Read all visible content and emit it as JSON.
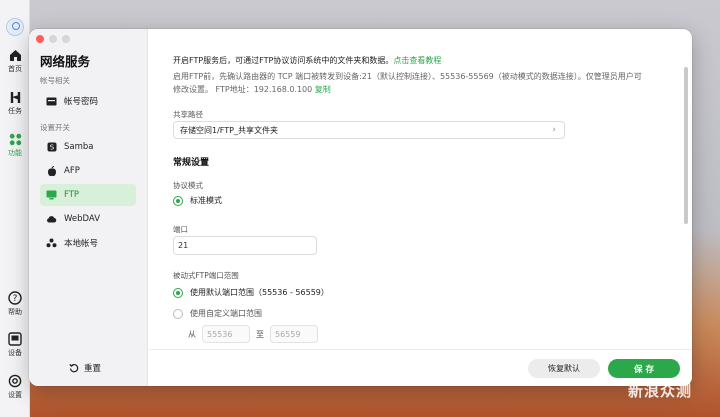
{
  "rail": {
    "items": [
      {
        "label": "首页",
        "icon": "home-icon"
      },
      {
        "label": "任务",
        "icon": "tasks-icon"
      },
      {
        "label": "功能",
        "icon": "apps-icon",
        "active": true
      },
      {
        "label": "帮助",
        "icon": "help-icon"
      },
      {
        "label": "设备",
        "icon": "device-icon"
      },
      {
        "label": "设置",
        "icon": "settings-icon"
      }
    ]
  },
  "sidebar": {
    "title": "网络服务",
    "group_account": "帐号相关",
    "group_settings": "设置开关",
    "items": [
      {
        "label": "帐号密码",
        "icon": "card-icon"
      },
      {
        "label": "Samba",
        "icon": "samba-icon"
      },
      {
        "label": "AFP",
        "icon": "apple-icon"
      },
      {
        "label": "FTP",
        "icon": "ftp-icon",
        "active": true
      },
      {
        "label": "WebDAV",
        "icon": "cloud-icon"
      },
      {
        "label": "本地帐号",
        "icon": "users-icon"
      }
    ],
    "reset_label": "重置"
  },
  "main": {
    "intro_line1": "开启FTP服务后，可通过FTP协议访问系统中的文件夹和数据。",
    "intro_link": "点击查看教程",
    "intro_line2": "启用FTP前，先确认路由器的 TCP 端口被转发到设备:21（默认控制连接）、55536-55569（被动模式的数据连接）。仅管理员用户可修改设置。 FTP地址：192.168.0.100",
    "copy_link": "复制",
    "share_path_label": "共享路径",
    "share_path_value": "存储空间1/FTP_共享文件夹",
    "section_title": "常规设置",
    "protocol_label": "协议模式",
    "protocol_option": "标准模式",
    "port_label": "端口",
    "port_value": "21",
    "passive_label": "被动式FTP端口范围",
    "passive_default": "使用默认端口范围（55536 - 56559）",
    "passive_custom": "使用自定义端口范围",
    "range_from_label": "从",
    "range_from_value": "55536",
    "range_to_label": "至",
    "range_to_value": "56559"
  },
  "footer": {
    "restore_label": "恢复默认",
    "save_label": "保 存"
  },
  "colors": {
    "accent": "#2aa84a",
    "close": "#ff5f57"
  },
  "watermark": "新浪众测"
}
